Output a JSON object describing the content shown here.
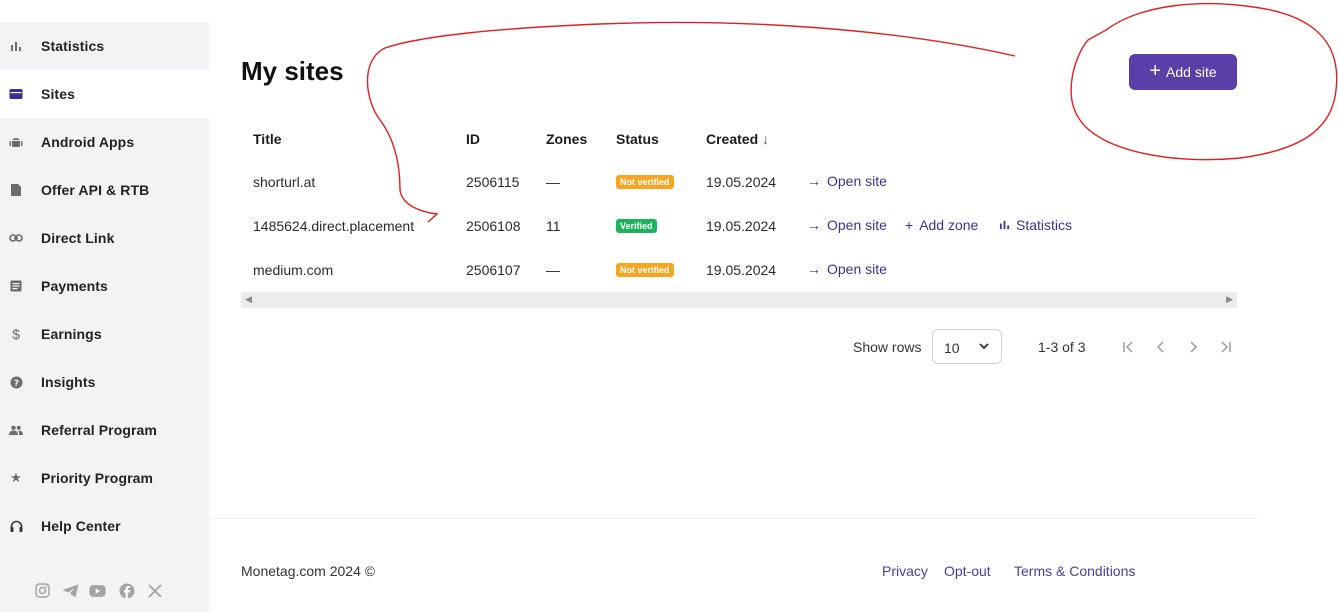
{
  "sidebar": {
    "items": [
      {
        "label": "Statistics",
        "icon": "bar-chart-icon",
        "active": false
      },
      {
        "label": "Sites",
        "icon": "browser-window-icon",
        "active": true
      },
      {
        "label": "Android Apps",
        "icon": "android-icon",
        "active": false
      },
      {
        "label": "Offer API & RTB",
        "icon": "document-icon",
        "active": false
      },
      {
        "label": "Direct Link",
        "icon": "link-icon",
        "active": false
      },
      {
        "label": "Payments",
        "icon": "list-document-icon",
        "active": false
      },
      {
        "label": "Earnings",
        "icon": "dollar-icon",
        "active": false
      },
      {
        "label": "Insights",
        "icon": "help-circle-icon",
        "active": false
      },
      {
        "label": "Referral Program",
        "icon": "people-icon",
        "active": false
      },
      {
        "label": "Priority Program",
        "icon": "star-icon",
        "active": false
      },
      {
        "label": "Help Center",
        "icon": "headset-icon",
        "active": false
      }
    ],
    "social": [
      "instagram-icon",
      "telegram-icon",
      "youtube-icon",
      "facebook-icon",
      "x-icon"
    ]
  },
  "page": {
    "title": "My sites",
    "add_button": "Add site"
  },
  "table": {
    "headers": [
      "Title",
      "ID",
      "Zones",
      "Status",
      "Created"
    ],
    "rows": [
      {
        "title": "shorturl.at",
        "id": "2506115",
        "zones": "—",
        "status": "Not verified",
        "created": "19.05.2024",
        "actions": [
          "Open site"
        ]
      },
      {
        "title": "1485624.direct.placement",
        "id": "2506108",
        "zones": "11",
        "status": "Verified",
        "created": "19.05.2024",
        "actions": [
          "Open site",
          "Add zone",
          "Statistics"
        ]
      },
      {
        "title": "medium.com",
        "id": "2506107",
        "zones": "—",
        "status": "Not verified",
        "created": "19.05.2024",
        "actions": [
          "Open site"
        ]
      }
    ]
  },
  "pagination": {
    "show_rows_label": "Show rows",
    "rows_value": "10",
    "range": "1-3 of 3"
  },
  "footer": {
    "copyright": "Monetag.com 2024 ©",
    "links": [
      "Privacy",
      "Opt-out",
      "Terms & Conditions"
    ]
  },
  "colors": {
    "accent": "#5b3fa8",
    "link": "#3d3191",
    "not_verified": "#f5a623",
    "verified": "#1bb35d",
    "annotation": "#e02020"
  }
}
